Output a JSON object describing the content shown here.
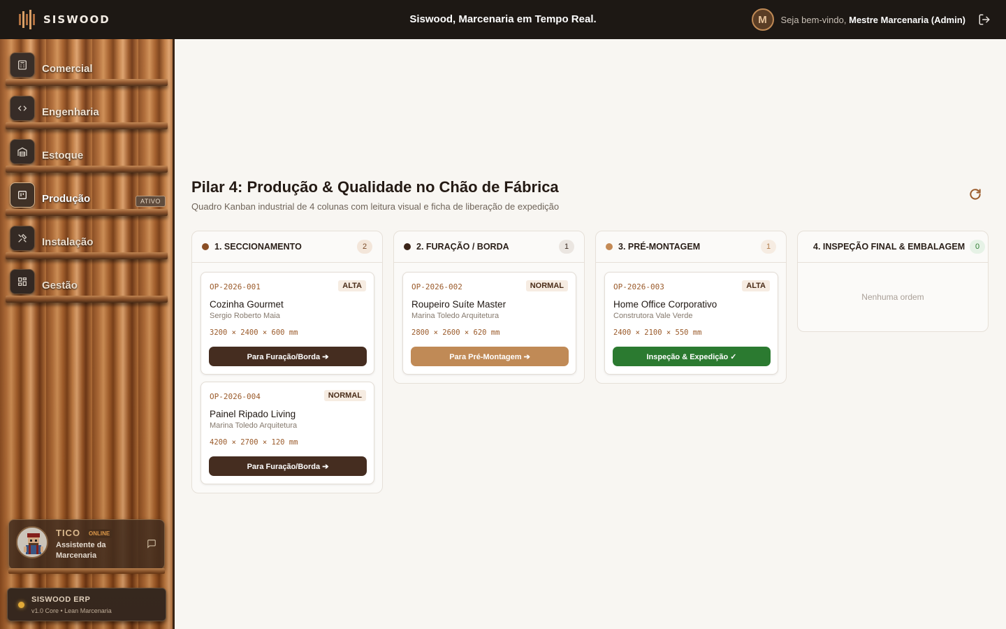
{
  "app": {
    "brand": "SISWOOD",
    "header_title": "Siswood, Marcenaria em Tempo Real.",
    "user_initial": "M",
    "welcome_prefix": "Seja bem-vindo,",
    "user_name": "Mestre Marcenaria (Admin)"
  },
  "sidebar": {
    "items": [
      {
        "label": "Comercial",
        "icon": "calculator-icon"
      },
      {
        "label": "Engenharia",
        "icon": "code-icon"
      },
      {
        "label": "Estoque",
        "icon": "warehouse-icon"
      },
      {
        "label": "Produção",
        "icon": "kanban-icon",
        "active": true,
        "badge": "ATIVO"
      },
      {
        "label": "Instalação",
        "icon": "tools-icon"
      },
      {
        "label": "Gestão",
        "icon": "dashboard-icon"
      }
    ],
    "assistant": {
      "name": "TICO",
      "status": "ONLINE",
      "description": "Assistente da Marcenaria"
    },
    "footer": {
      "title": "SISWOOD ERP",
      "subtitle": "v1.0 Core • Lean Marcenaria"
    }
  },
  "main": {
    "title": "Pilar 4: Produção & Qualidade no Chão de Fábrica",
    "subtitle": "Quadro Kanban industrial de 4 colunas com leitura visual e ficha de liberação de expedição",
    "columns": [
      {
        "title": "1. SECCIONAMENTO",
        "count": "2",
        "dot_color": "#8a4e25",
        "cards": [
          {
            "code": "OP-2026-001",
            "priority": "ALTA",
            "name": "Cozinha Gourmet",
            "client": "Sergio Roberto Maia",
            "dims": "3200 × 2400 × 600 mm",
            "action": "Para Furação/Borda ➔"
          },
          {
            "code": "OP-2026-004",
            "priority": "NORMAL",
            "name": "Painel Ripado Living",
            "client": "Marina Toledo Arquitetura",
            "dims": "4200 × 2700 × 120 mm",
            "action": "Para Furação/Borda ➔"
          }
        ]
      },
      {
        "title": "2. FURAÇÃO / BORDA",
        "count": "1",
        "dot_color": "#3b2418",
        "cards": [
          {
            "code": "OP-2026-002",
            "priority": "NORMAL",
            "name": "Roupeiro Suíte Master",
            "client": "Marina Toledo Arquitetura",
            "dims": "2800 × 2600 × 620 mm",
            "action": "Para Pré-Montagem ➔"
          }
        ]
      },
      {
        "title": "3. PRÉ-MONTAGEM",
        "count": "1",
        "dot_color": "#c48a55",
        "cards": [
          {
            "code": "OP-2026-003",
            "priority": "ALTA",
            "name": "Home Office Corporativo",
            "client": "Construtora Vale Verde",
            "dims": "2400 × 2100 × 550 mm",
            "action": "Inspeção & Expedição ✓"
          }
        ]
      },
      {
        "title": "4. INSPEÇÃO FINAL & EMBALAGEM",
        "count": "0",
        "dot_color": "#2e7d32",
        "empty": "Nenhuma ordem",
        "cards": []
      }
    ]
  },
  "colors": {
    "btn_dark": "#452d20",
    "btn_light": "#c08a56",
    "btn_green": "#2b7a30",
    "accent": "#9a5a2a"
  }
}
